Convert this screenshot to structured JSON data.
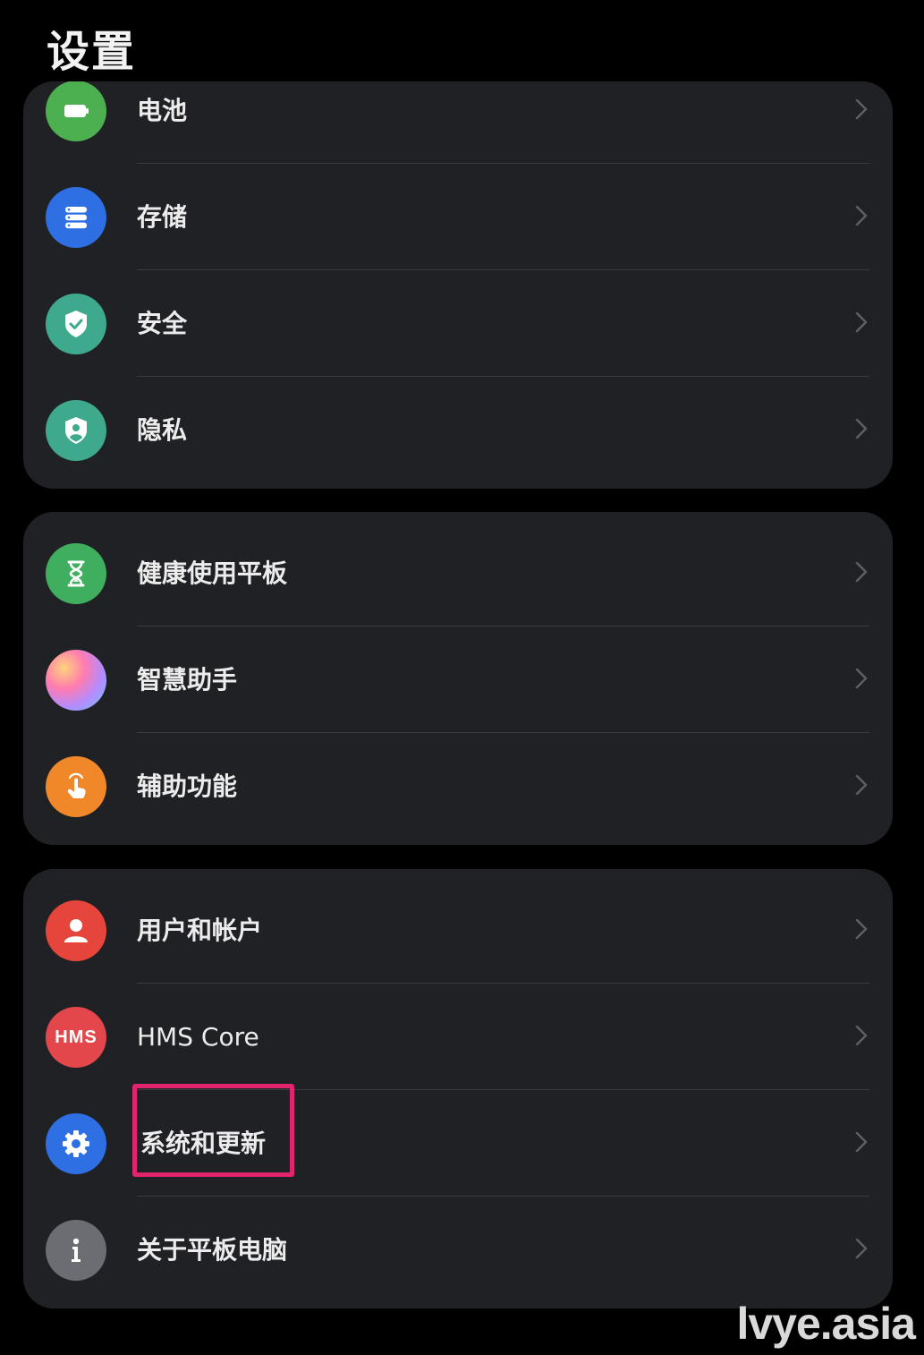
{
  "page": {
    "title": "设置"
  },
  "groups": [
    {
      "items": [
        {
          "label": "电池",
          "icon": "battery-icon",
          "color": "#4caf50"
        },
        {
          "label": "存储",
          "icon": "storage-icon",
          "color": "#2f6fe4"
        },
        {
          "label": "安全",
          "icon": "shield-check-icon",
          "color": "#3fa98d"
        },
        {
          "label": "隐私",
          "icon": "privacy-shield-icon",
          "color": "#3fa98d"
        }
      ]
    },
    {
      "items": [
        {
          "label": "健康使用平板",
          "icon": "hourglass-icon",
          "color": "#3fae5e"
        },
        {
          "label": "智慧助手",
          "icon": "assistant-orb-icon",
          "color": "#c58bff"
        },
        {
          "label": "辅助功能",
          "icon": "touch-hand-icon",
          "color": "#f0882a"
        }
      ]
    },
    {
      "items": [
        {
          "label": "用户和帐户",
          "icon": "user-icon",
          "color": "#e5453a"
        },
        {
          "label": "HMS Core",
          "icon": "hms-icon",
          "icon_text": "HMS",
          "color": "#e4474b"
        },
        {
          "label": "系统和更新",
          "icon": "gear-icon",
          "color": "#2f6fe4"
        },
        {
          "label": "关于平板电脑",
          "icon": "info-icon",
          "color": "#6b6d72"
        }
      ]
    }
  ],
  "watermark": "lvye.asia",
  "highlight_color": "#e0246e"
}
